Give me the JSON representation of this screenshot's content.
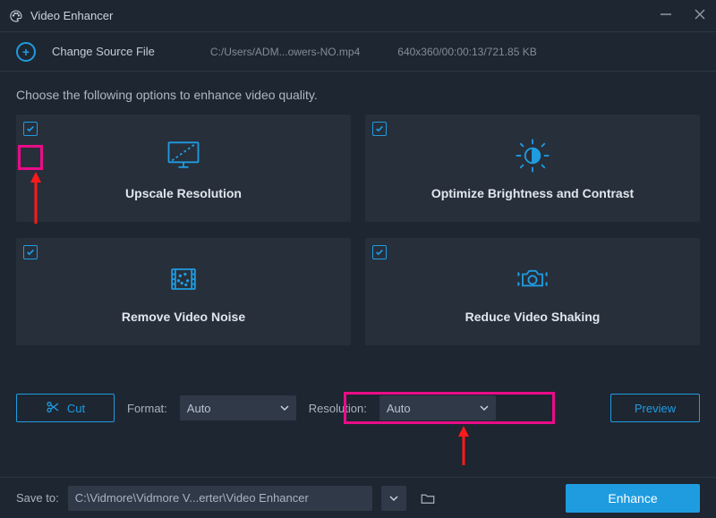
{
  "window": {
    "title": "Video Enhancer"
  },
  "top": {
    "change_source_label": "Change Source File",
    "file_path": "C:/Users/ADM...owers-NO.mp4",
    "file_meta": "640x360/00:00:13/721.85 KB"
  },
  "instruction": "Choose the following options to enhance video quality.",
  "cards": [
    {
      "title": "Upscale Resolution",
      "checked": true
    },
    {
      "title": "Optimize Brightness and Contrast",
      "checked": true
    },
    {
      "title": "Remove Video Noise",
      "checked": true
    },
    {
      "title": "Reduce Video Shaking",
      "checked": true
    }
  ],
  "controls": {
    "cut_label": "Cut",
    "format_label": "Format:",
    "format_value": "Auto",
    "resolution_label": "Resolution:",
    "resolution_value": "Auto",
    "preview_label": "Preview"
  },
  "footer": {
    "save_to_label": "Save to:",
    "save_path": "C:\\Vidmore\\Vidmore V...erter\\Video Enhancer",
    "enhance_label": "Enhance"
  }
}
